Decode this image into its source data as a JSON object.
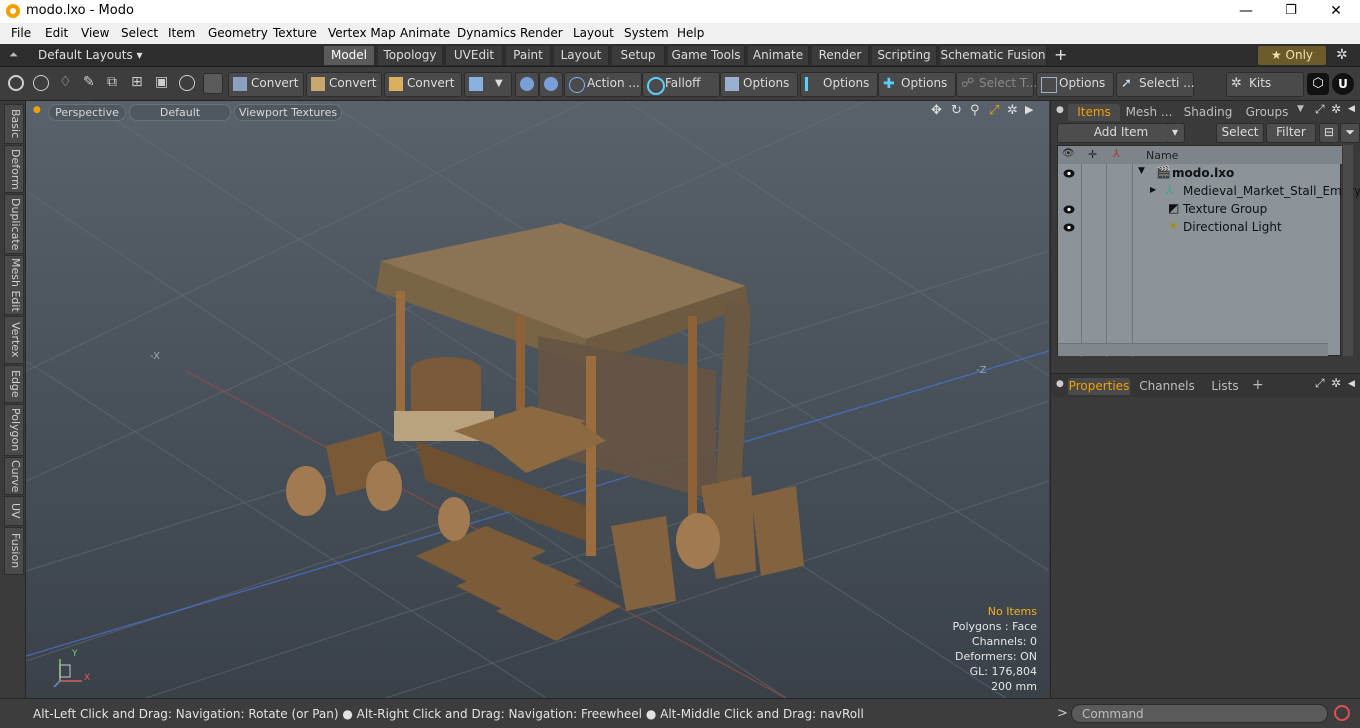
{
  "window": {
    "title": "modo.lxo - Modo",
    "controls": [
      "—",
      "❐",
      "✕"
    ]
  },
  "menu": [
    "File",
    "Edit",
    "View",
    "Select",
    "Item",
    "Geometry",
    "Texture",
    "Vertex Map",
    "Animate",
    "Dynamics",
    "Render",
    "Layout",
    "System",
    "Help"
  ],
  "layouts": {
    "selector": "Default Layouts ▾",
    "tabs": [
      "Model",
      "Topology",
      "UVEdit",
      "Paint",
      "Layout",
      "Setup",
      "Game Tools",
      "Animate",
      "Render",
      "Scripting",
      "Schematic Fusion"
    ],
    "active": "Model",
    "add": "+",
    "only": "★  Only",
    "gear": "✲"
  },
  "toolbar": {
    "convert1": "Convert",
    "convert2": "Convert",
    "convert3": "Convert",
    "action": "Action ...",
    "falloff": "Falloff",
    "options1": "Options",
    "options2": "Options",
    "options3": "Options",
    "select_t": "Select T...",
    "options4": "Options",
    "selecti": "Selecti ...",
    "kits": "Kits"
  },
  "left_tabs": [
    "Basic",
    "Deform",
    "Duplicate",
    "Mesh Edit",
    "Vertex",
    "Edge",
    "Polygon",
    "Curve",
    "UV",
    "Fusion"
  ],
  "viewport": {
    "view": "Perspective",
    "shading": "Default",
    "textures": "Viewport Textures",
    "axis_x": "-X",
    "axis_z": "-Z",
    "stats": {
      "selection": "No Items",
      "polygons": "Polygons : Face",
      "channels": "Channels: 0",
      "deformers": "Deformers: ON",
      "gl": "GL: 176,804",
      "scale": "200 mm"
    },
    "gizmo": {
      "y": "Y",
      "x": "X"
    }
  },
  "items_panel": {
    "tabs": [
      "Items",
      "Mesh ...",
      "Shading",
      "Groups"
    ],
    "active": "Items",
    "add_item": "Add Item",
    "select": "Select",
    "filter": "Filter",
    "column_name": "Name",
    "rows": [
      {
        "name": "modo.lxo",
        "bold": true,
        "eye": true
      },
      {
        "name": "Medieval_Market_Stall_Empty",
        "eye": false
      },
      {
        "name": "Texture Group",
        "eye": true
      },
      {
        "name": "Directional Light",
        "eye": true
      }
    ]
  },
  "properties_panel": {
    "tabs": [
      "Properties",
      "Channels",
      "Lists"
    ],
    "active": "Properties",
    "add": "+"
  },
  "statusbar": {
    "hint": "Alt-Left Click and Drag: Navigation: Rotate (or Pan) ● Alt-Right Click and Drag: Navigation: Freewheel ● Alt-Middle Click and Drag: navRoll",
    "prompt": ">",
    "command_placeholder": "Command"
  }
}
